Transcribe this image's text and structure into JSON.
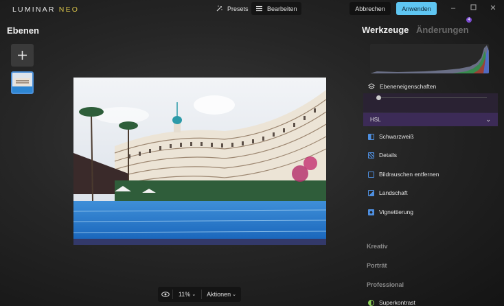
{
  "app": {
    "logo_main": "LUMINAR",
    "logo_accent": "NEO"
  },
  "topbar": {
    "presets_label": "Presets",
    "edit_label": "Bearbeiten",
    "cancel_label": "Abbrechen",
    "apply_label": "Anwenden"
  },
  "left": {
    "title": "Ebenen"
  },
  "bottom": {
    "zoom": "11%",
    "actions": "Aktionen"
  },
  "right": {
    "tab_tools": "Werkzeuge",
    "tab_changes": "Änderungen",
    "changes_count": "4",
    "layer_props": "Ebeneneigenschaften",
    "hsl": "HSL",
    "tools": [
      {
        "label": "Schwarzweiß",
        "icon": "bw-icon"
      },
      {
        "label": "Details",
        "icon": "details-icon"
      },
      {
        "label": "Bildrauschen entfernen",
        "icon": "denoise-icon"
      },
      {
        "label": "Landschaft",
        "icon": "landscape-icon"
      },
      {
        "label": "Vignettierung",
        "icon": "vignette-icon"
      }
    ],
    "categories": [
      "Kreativ",
      "Porträt",
      "Professional"
    ],
    "superkontrast": "Superkontrast"
  },
  "colors": {
    "accent": "#5fc6f2",
    "hsl_bg": "#3c2b57",
    "badge": "#7a4bd0"
  }
}
